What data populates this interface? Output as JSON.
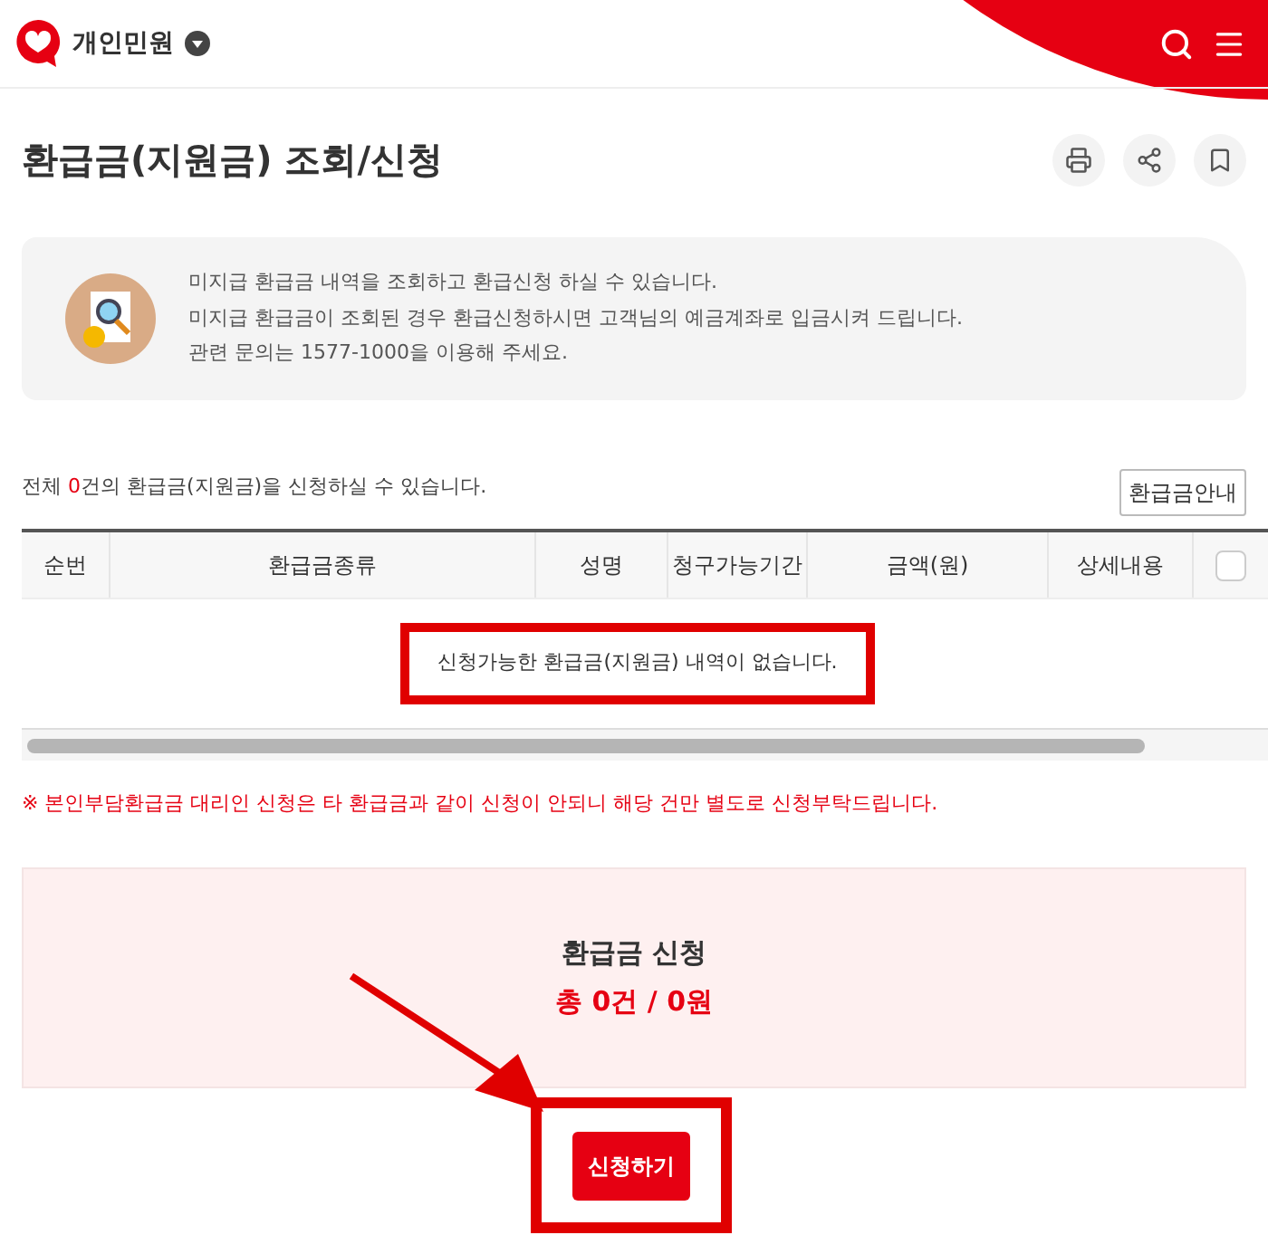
{
  "header": {
    "category": "개인민원"
  },
  "page": {
    "title": "환급금(지원금) 조회/신청"
  },
  "info": {
    "lines": [
      "미지급 환급금 내역을 조회하고 환급신청 하실 수 있습니다.",
      "미지급 환급금이 조회된 경우 환급신청하시면 고객님의 예금계좌로 입금시켜 드립니다.",
      "관련 문의는 1577-1000을 이용해 주세요."
    ]
  },
  "count_text": {
    "before": "전체 ",
    "count": "0",
    "after": "건의 환급금(지원금)을 신청하실 수 있습니다."
  },
  "guide_button": "환급금안내",
  "table": {
    "columns": [
      {
        "kind": "text",
        "label": "순번"
      },
      {
        "kind": "text",
        "label": "환급금종류"
      },
      {
        "kind": "text",
        "label": "성명"
      },
      {
        "kind": "text",
        "label": "청구가능기간"
      },
      {
        "kind": "text",
        "label": "금액(원)"
      },
      {
        "kind": "text",
        "label": "상세내용"
      },
      {
        "kind": "checkbox",
        "checked": false
      }
    ],
    "empty_message": "신청가능한 환급금(지원금) 내역이 없습니다."
  },
  "notice": "※ 본인부담환급금 대리인 신청은 타 환급금과 같이 신청이 안되니 해당 건만 별도로 신청부탁드립니다.",
  "summary": {
    "title": "환급금 신청",
    "total": "총 0건 / 0원"
  },
  "submit_button": "신청하기"
}
